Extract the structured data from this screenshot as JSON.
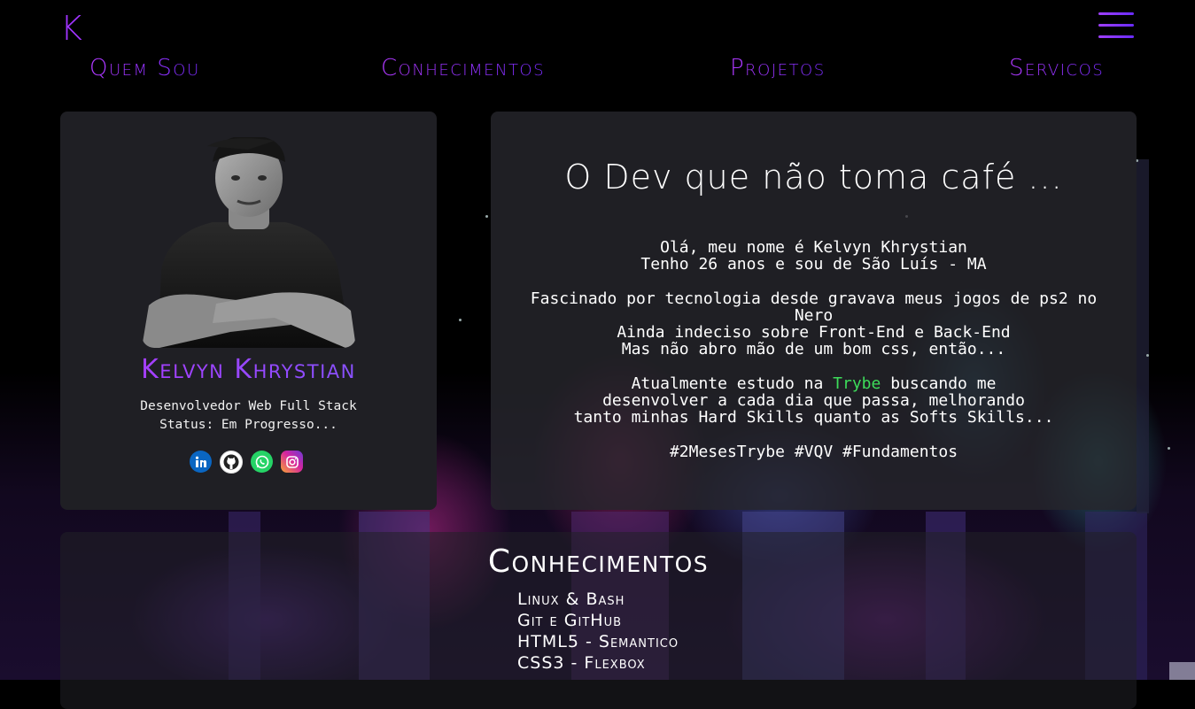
{
  "header": {
    "logo": "K",
    "menu_icon": "hamburger-icon",
    "nav": [
      "Quem Sou",
      "Conhecimentos",
      "Projetos",
      "Servicos"
    ]
  },
  "profile": {
    "name": "Kelvyn Khrystian",
    "role": "Desenvolvedor Web Full Stack",
    "status": "Status: Em Progresso...",
    "socials": [
      {
        "name": "linkedin-icon",
        "color": "#0a66c2"
      },
      {
        "name": "github-icon",
        "color": "#ffffff"
      },
      {
        "name": "whatsapp-icon",
        "color": "#25d366"
      },
      {
        "name": "instagram-icon",
        "color": "#d6249f"
      }
    ]
  },
  "about": {
    "title": "O Dev que não toma café ...",
    "line1": "Olá, meu nome é Kelvyn Khrystian",
    "line2": "Tenho 26 anos e sou de São Luís - MA",
    "line3": "Fascinado por tecnologia desde gravava meus jogos de ps2 no Nero",
    "line4": "Ainda indeciso sobre Front-End e Back-End",
    "line5": "Mas não abro mão de um bom css, então...",
    "line6_pre": "Atualmente estudo na ",
    "line6_highlight": "Trybe",
    "line6_post": " buscando me",
    "line7": "desenvolver a cada dia que passa, melhorando",
    "line8": "tanto minhas Hard Skills quanto as Softs Skills...",
    "tags": "#2MesesTrybe #VQV #Fundamentos"
  },
  "skills": {
    "title": "Conhecimentos",
    "items": [
      "Linux & Bash",
      "Git e GitHub",
      "HTML5 - Semantico",
      "CSS3 - Flexbox"
    ]
  },
  "colors": {
    "accent": "#a033ff",
    "highlight": "#3ddc5a"
  }
}
